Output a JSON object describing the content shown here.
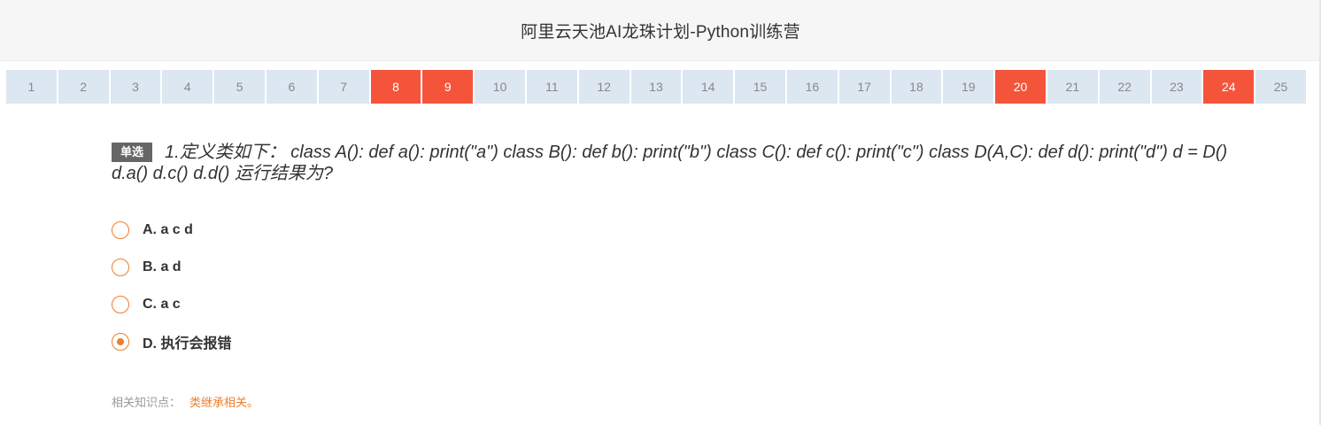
{
  "header": {
    "title": "阿里云天池AI龙珠计划-Python训练营"
  },
  "question_nav": [
    {
      "label": "1",
      "answered": false
    },
    {
      "label": "2",
      "answered": false
    },
    {
      "label": "3",
      "answered": false
    },
    {
      "label": "4",
      "answered": false
    },
    {
      "label": "5",
      "answered": false
    },
    {
      "label": "6",
      "answered": false
    },
    {
      "label": "7",
      "answered": false
    },
    {
      "label": "8",
      "answered": true
    },
    {
      "label": "9",
      "answered": true
    },
    {
      "label": "10",
      "answered": false
    },
    {
      "label": "11",
      "answered": false
    },
    {
      "label": "12",
      "answered": false
    },
    {
      "label": "13",
      "answered": false
    },
    {
      "label": "14",
      "answered": false
    },
    {
      "label": "15",
      "answered": false
    },
    {
      "label": "16",
      "answered": false
    },
    {
      "label": "17",
      "answered": false
    },
    {
      "label": "18",
      "answered": false
    },
    {
      "label": "19",
      "answered": false
    },
    {
      "label": "20",
      "answered": true
    },
    {
      "label": "21",
      "answered": false
    },
    {
      "label": "22",
      "answered": false
    },
    {
      "label": "23",
      "answered": false
    },
    {
      "label": "24",
      "answered": true
    },
    {
      "label": "25",
      "answered": false
    }
  ],
  "question": {
    "type_badge": "单选",
    "text": "1.定义类如下：  class A(): def a(): print(\"a\") class B(): def b(): print(\"b\") class C(): def c(): print(\"c\") class D(A,C): def d(): print(\"d\") d = D() d.a() d.c() d.d() 运行结果为?"
  },
  "options": [
    {
      "label": "A. a c d",
      "selected": false
    },
    {
      "label": "B. a d",
      "selected": false
    },
    {
      "label": "C. a c",
      "selected": false
    },
    {
      "label": "D. 执行会报错",
      "selected": true
    }
  ],
  "knowledge": {
    "label": "相关知识点：",
    "topic": "类继承相关。"
  },
  "colors": {
    "answered": "#f4553a",
    "unanswered": "#dde7f1",
    "accent": "#f07c2c"
  }
}
